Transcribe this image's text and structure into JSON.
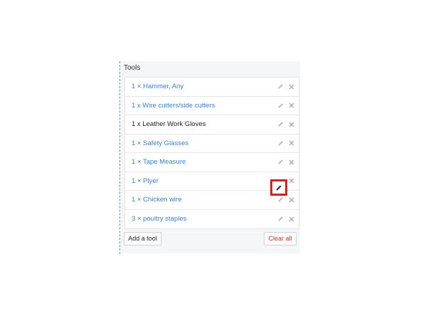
{
  "panel": {
    "title": "Tools"
  },
  "tools": [
    {
      "label": "1 × Hammer, Any"
    },
    {
      "label": "1 x Wire cutters/side cutters"
    },
    {
      "label": "1 x Leather Work Gloves"
    },
    {
      "label": "1 × Safety Glasses"
    },
    {
      "label": "1 × Tape Measure"
    },
    {
      "label": "1 × Plyer"
    },
    {
      "label": "1 × Chicken wire"
    },
    {
      "label": "3 × poultry staples"
    }
  ],
  "buttons": {
    "add_label": "Add a tool",
    "clear_label": "Clear all"
  },
  "colors": {
    "link": "#3d7fc6",
    "danger": "#c9302c",
    "highlight": "#c42a1c",
    "dashed_rule": "#5b8fc7"
  },
  "icons": {
    "edit": "pencil-icon",
    "remove": "close-icon"
  },
  "active_row_index": 2
}
